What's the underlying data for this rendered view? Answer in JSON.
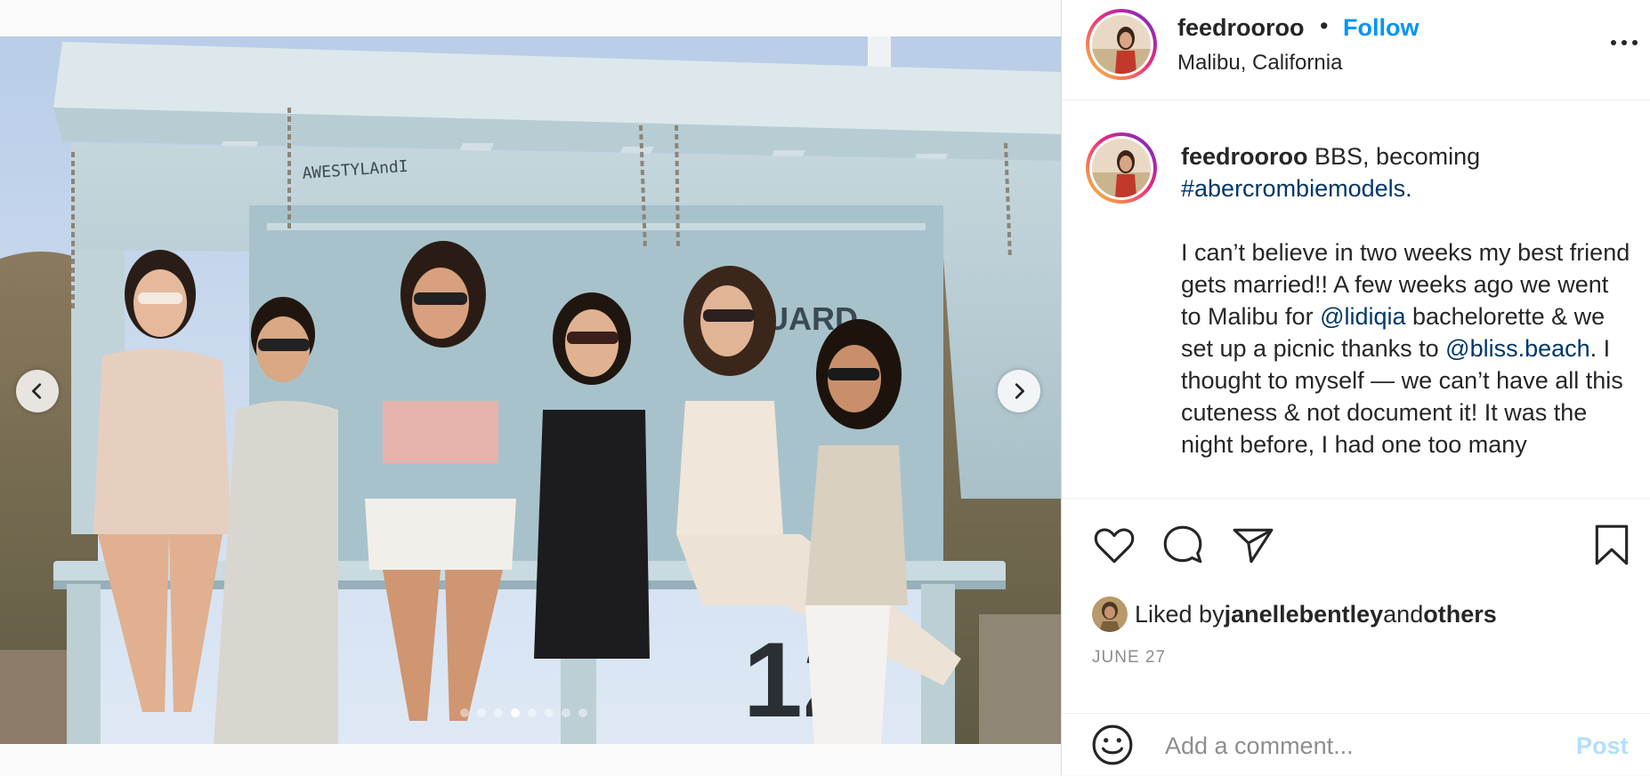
{
  "post": {
    "username": "feedrooroo",
    "separator": "•",
    "follow_label": "Follow",
    "location": "Malibu, California",
    "more_icon": "more-options-icon"
  },
  "media": {
    "slide_count": 8,
    "active_slide": 4,
    "prev_icon": "chevron-left-icon",
    "next_icon": "chevron-right-icon",
    "photo_text": {
      "tower_number": "12",
      "sign": "UARD",
      "graffiti": "AWESTYLAndI"
    }
  },
  "caption": {
    "username": "feedrooroo",
    "line1_text": " BBS, becoming ",
    "hashtag": "#abercrombiemodels.",
    "body_1": "I can’t believe in two weeks my best friend gets married!! A few weeks ago we went to Malibu for ",
    "mention_1": "@lidiqia",
    "body_2": " bachelorette & we set up a picnic thanks to ",
    "mention_2": "@bliss.beach",
    "body_3": ". I thought to myself — we can’t have all this cuteness & not document it! It was the night before, I had one too many"
  },
  "actions": {
    "like_icon": "heart-icon",
    "comment_icon": "comment-bubble-icon",
    "share_icon": "paper-plane-icon",
    "save_icon": "bookmark-icon"
  },
  "likes": {
    "prefix": "Liked by ",
    "user": "janellebentley",
    "middle": " and ",
    "others": "others"
  },
  "date": "JUNE 27",
  "comment_box": {
    "placeholder": "Add a comment...",
    "post_label": "Post",
    "emoji_icon": "smiley-face-icon"
  },
  "colors": {
    "link_blue": "#0095f6",
    "mention_dark_blue": "#00376b",
    "post_disabled": "#b2dffc",
    "meta_gray": "#8e8e8e"
  }
}
